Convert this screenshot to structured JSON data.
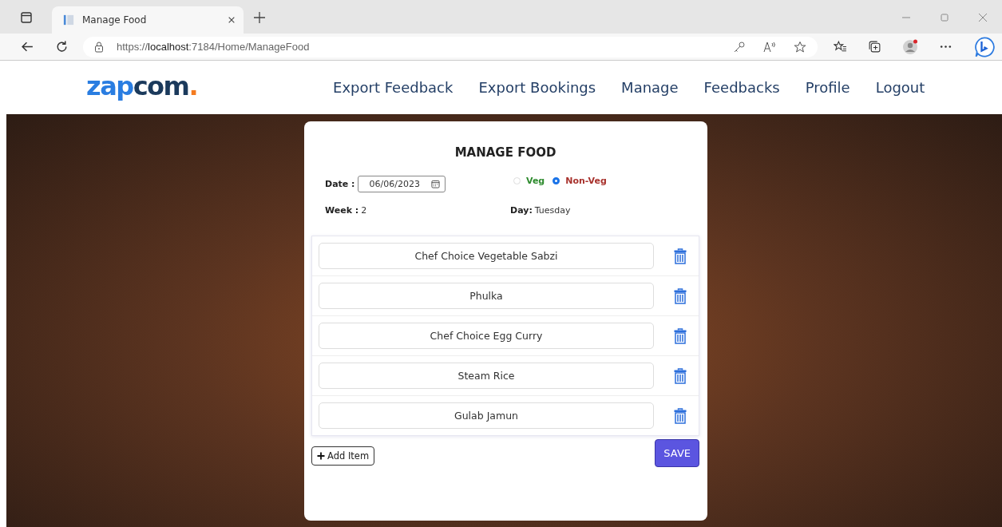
{
  "browser": {
    "tab_title": "Manage Food",
    "url_prefix": "https://",
    "url_host": "localhost",
    "url_rest": ":7184/Home/ManageFood"
  },
  "logo": {
    "parts": [
      {
        "text": "zap",
        "color": "#2a7de1"
      },
      {
        "text": "com",
        "color": "#1b3a5c"
      },
      {
        "text": ".",
        "color": "#f47b20"
      }
    ]
  },
  "nav": [
    "Export Feedback",
    "Export Bookings",
    "Manage",
    "Feedbacks",
    "Profile",
    "Logout"
  ],
  "form": {
    "title": "MANAGE FOOD",
    "date_label": "Date :",
    "date_value": "06/06/2023",
    "food_types": [
      {
        "label": "Veg",
        "selected": false,
        "color": "#2e8b2e"
      },
      {
        "label": "Non-Veg",
        "selected": true,
        "color": "#a8322d"
      }
    ],
    "week_label": "Week :",
    "week_value": "2",
    "day_label": "Day:",
    "day_value": "Tuesday",
    "items": [
      "Chef Choice Vegetable Sabzi",
      "Phulka",
      "Chef Choice Egg Curry",
      "Steam Rice",
      "Gulab Jamun"
    ],
    "add_button": "Add Item",
    "save_button": "SAVE"
  }
}
